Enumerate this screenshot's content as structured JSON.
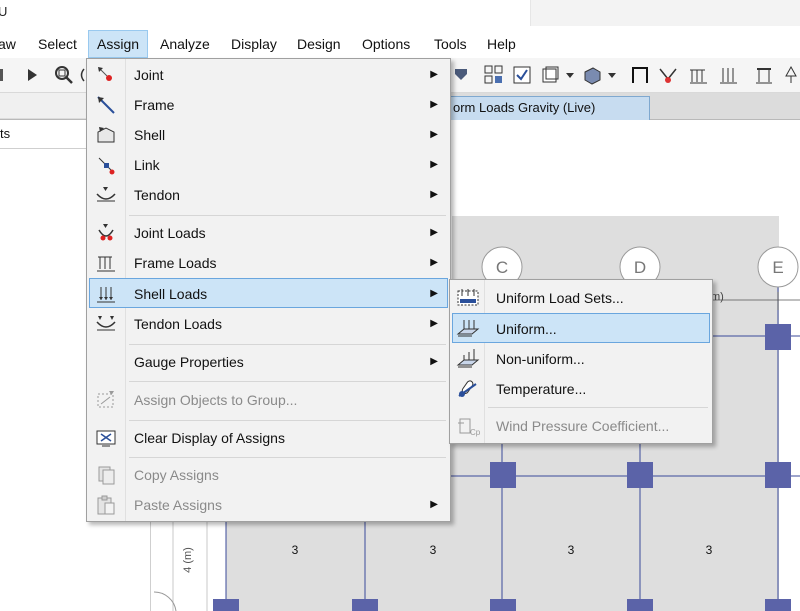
{
  "title_fragment": "U",
  "menubar": {
    "items": [
      "aw",
      "Select",
      "Assign",
      "Analyze",
      "Display",
      "Design",
      "Options",
      "Tools",
      "Help"
    ]
  },
  "left_panel": {
    "header": "ts"
  },
  "model_tab": {
    "label": "orm Loads Gravity  (Live)"
  },
  "assign_menu": {
    "items": [
      {
        "label": "Joint",
        "submenu": true,
        "icon": "joint-icon"
      },
      {
        "label": "Frame",
        "submenu": true,
        "icon": "frame-icon"
      },
      {
        "label": "Shell",
        "submenu": true,
        "icon": "shell-icon"
      },
      {
        "label": "Link",
        "submenu": true,
        "icon": "link-icon"
      },
      {
        "label": "Tendon",
        "submenu": true,
        "icon": "tendon-icon"
      },
      {
        "label": "Joint Loads",
        "submenu": true,
        "icon": "joint-loads-icon"
      },
      {
        "label": "Frame Loads",
        "submenu": true,
        "icon": "frame-loads-icon"
      },
      {
        "label": "Shell Loads",
        "submenu": true,
        "icon": "shell-loads-icon",
        "highlighted": true
      },
      {
        "label": "Tendon Loads",
        "submenu": true,
        "icon": "tendon-loads-icon"
      },
      {
        "label": "Gauge Properties",
        "submenu": true,
        "icon": ""
      },
      {
        "label": "Assign Objects to Group...",
        "submenu": false,
        "icon": "group-icon",
        "disabled": true
      },
      {
        "label": "Clear Display of Assigns",
        "submenu": false,
        "icon": "clear-display-icon"
      },
      {
        "label": "Copy Assigns",
        "submenu": false,
        "icon": "copy-icon",
        "disabled": true
      },
      {
        "label": "Paste Assigns",
        "submenu": true,
        "icon": "paste-icon",
        "disabled": true
      }
    ]
  },
  "shell_loads_submenu": {
    "items": [
      {
        "label": "Uniform Load Sets...",
        "icon": "uniform-load-sets-icon"
      },
      {
        "label": "Uniform...",
        "icon": "uniform-load-icon",
        "highlighted": true
      },
      {
        "label": "Non-uniform...",
        "icon": "non-uniform-load-icon"
      },
      {
        "label": "Temperature...",
        "icon": "temperature-icon"
      },
      {
        "label": "Wind Pressure Coefficient...",
        "icon": "wind-pressure-icon",
        "disabled": true
      }
    ]
  },
  "drawing": {
    "grid_bubbles": [
      "C",
      "D",
      "E"
    ],
    "dimension_fragment": "m)",
    "shell_labels": [
      "3",
      "3",
      "3",
      "3"
    ],
    "dim_label": "4 (m)"
  },
  "colors": {
    "menu_bg": "#f2f2f2",
    "highlight_bg": "#cce4f7",
    "highlight_border": "#6aa6de",
    "shell_fill": "#dedede",
    "column_fill": "#5b63a8",
    "grid_line": "#3b4a9a"
  }
}
